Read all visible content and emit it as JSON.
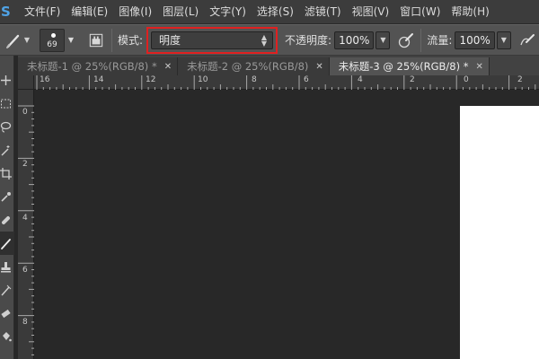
{
  "app": {
    "logo": "S"
  },
  "menu": [
    "文件(F)",
    "编辑(E)",
    "图像(I)",
    "图层(L)",
    "文字(Y)",
    "选择(S)",
    "滤镜(T)",
    "视图(V)",
    "窗口(W)",
    "帮助(H)"
  ],
  "options": {
    "brush_size": "69",
    "mode_label": "模式:",
    "mode_value": "明度",
    "opacity_label": "不透明度:",
    "opacity_value": "100%",
    "flow_label": "流量:",
    "flow_value": "100%"
  },
  "tabs": [
    {
      "label": "未标题-1 @ 25%(RGB/8) *",
      "active": false
    },
    {
      "label": "未标题-2 @ 25%(RGB/8)",
      "active": false
    },
    {
      "label": "未标题-3 @ 25%(RGB/8) *",
      "active": true
    }
  ],
  "ruler": {
    "horizontal": [
      "16",
      "14",
      "12",
      "10",
      "8",
      "6",
      "4",
      "2",
      "0",
      "2"
    ],
    "vertical": [
      "0",
      "2",
      "4",
      "6",
      "8"
    ]
  },
  "colors": {
    "accent": "#4fa3e6",
    "highlight": "#e02020",
    "document": "#ffffff"
  },
  "icons": {
    "tool_preset": "brush-icon",
    "panel_toggle": "brush-panel-icon",
    "opacity_pressure": "pressure-icon",
    "airbrush": "airbrush-icon"
  }
}
